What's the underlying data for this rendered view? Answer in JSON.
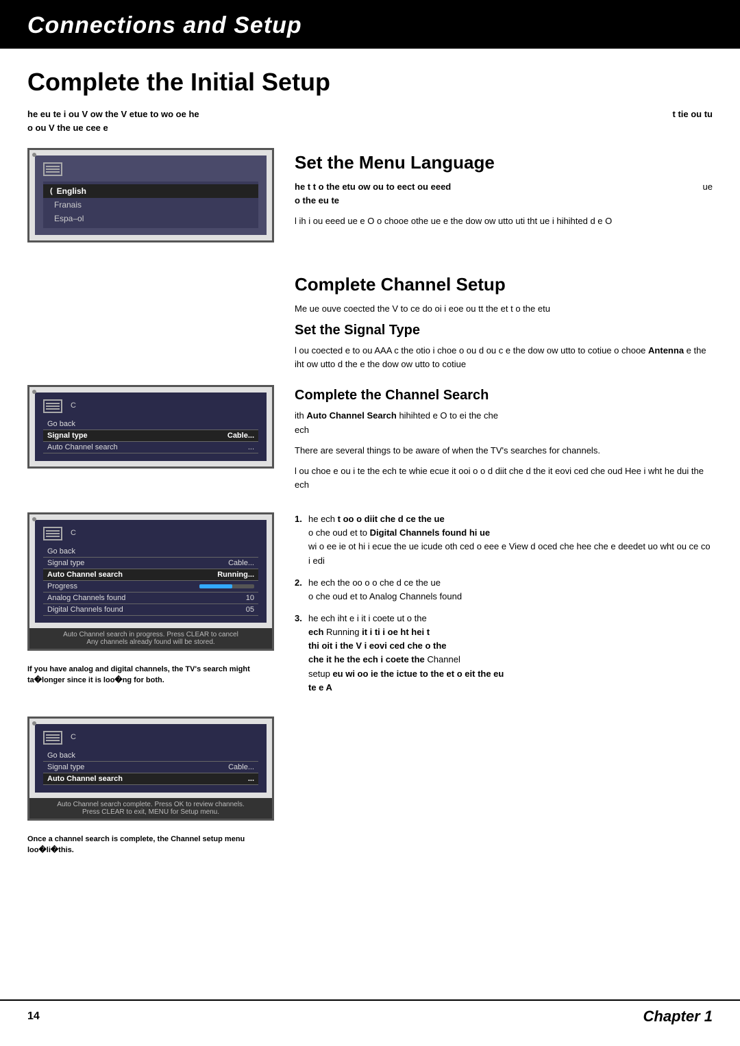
{
  "header": {
    "title": "Connections and Setup"
  },
  "page": {
    "title": "Complete the Initial Setup",
    "intro_line1": "he eu te i ou V ow the V etue to wo oe he",
    "intro_line1_right": "t tie ou tu",
    "intro_line2": "o ou V the ue cee e"
  },
  "menu_language_section": {
    "heading": "Set the Menu Language",
    "body1_bold": "he  t t o the etu ow ou to eect ou eeed",
    "body1_right": "ue",
    "body1_line2": "o the eu te",
    "body2": "l ih i ou eeed ue e O o chooe othe ue e the dow ow utto uti tht ue i hihihted d e O"
  },
  "tv_screen_language": {
    "corner": "●",
    "icon_label": "",
    "menu_items": [
      {
        "label": "English",
        "selected": true,
        "check": "("
      },
      {
        "label": "Franais",
        "selected": false,
        "check": ""
      },
      {
        "label": "Espa–ol",
        "selected": false,
        "check": ""
      }
    ]
  },
  "channel_setup_section": {
    "heading": "Complete Channel Setup",
    "body1": "Me ue ouve coected the V to ce do  oi i eoe ou tt the et t o the etu"
  },
  "signal_type_section": {
    "sub_heading": "Set the Signal Type",
    "body1": "l ou coected e to ou AAA c the otio i choe o ou d ou c e the dow ow utto to cotiue o chooe",
    "body1_antenna": "Antenna",
    "body1_cont": "e the iht ow utto d the e the dow ow utto to cotiue"
  },
  "tv_screen_signal": {
    "c_label": "C",
    "rows": [
      {
        "label": "Go back",
        "value": "",
        "highlighted": false
      },
      {
        "label": "Signal type",
        "value": "Cable...",
        "highlighted": true
      },
      {
        "label": "Auto Channel search",
        "value": "...",
        "highlighted": false
      }
    ]
  },
  "channel_search_section": {
    "sub_heading": "Complete the Channel Search",
    "body_prefix": "ith",
    "body_bold": "Auto Channel Search",
    "body_mid": "hihihted e O to ei the che",
    "body_end": "ech",
    "note": "There are several things to be aware of when the TV's searches for channels.",
    "body2": "l ou choe e  ou i te the ech te  whie ecue it ooi o o d diit che d the it eovi ced che oud Hee i wht he dui the ech"
  },
  "tv_screen_running": {
    "c_label": "C",
    "rows": [
      {
        "label": "Go back",
        "value": "",
        "highlighted": false
      },
      {
        "label": "Signal type",
        "value": "Cable...",
        "highlighted": false
      },
      {
        "label": "Auto Channel search",
        "value": "Running...",
        "highlighted": true
      },
      {
        "label": "Progress",
        "value": "bar",
        "highlighted": false
      },
      {
        "label": "Analog Channels found",
        "value": "10",
        "highlighted": false
      },
      {
        "label": "Digital Channels found",
        "value": "05",
        "highlighted": false
      }
    ],
    "note": "Auto Channel search in progress. Press CLEAR to cancel",
    "note2": "Any channels already found will be stored."
  },
  "tv_screen_running_caption": "If you have analog and digital channels, the TV's search might ta�longer since it is loo�ng for both.",
  "numbered_items": [
    {
      "num": "1.",
      "text_before": "he ech",
      "text_bold1": "t oo o diit che d ce the ue",
      "text_after1": "o che oud et to",
      "text_bold2": "Digital Channels found",
      "text_after2": "hi ue wi o ee ie  ot hi i ecue the ue icude oth ced o eee  e View d oced che hee che e deedet uo wht ou ce co i edi"
    },
    {
      "num": "2.",
      "text_before": "he ech the oo o o che d ce the ue",
      "text_after1": "o che oud et to",
      "text_bold2": "Analog Channels found"
    },
    {
      "num": "3.",
      "text_before": "he ech iht e  i it i coete ut  o the",
      "text_bold1": "ech",
      "text_mid": "Running",
      "text_bold2": "it i ti i oe ht hei t thi oit i the V i eovi ced che o the che it he the ech i",
      "text_bold3": "coete the",
      "text_right": "Channel",
      "text_last": "setup eu wi oo ie the ictue to the et o eit the eu te e A"
    }
  ],
  "tv_screen_complete": {
    "c_label": "C",
    "rows": [
      {
        "label": "Go back",
        "value": "",
        "highlighted": false
      },
      {
        "label": "Signal type",
        "value": "Cable...",
        "highlighted": false
      },
      {
        "label": "Auto Channel search",
        "value": "...",
        "highlighted": true
      }
    ],
    "note": "Auto Channel search complete. Press OK to review channels.",
    "note2": "Press CLEAR to exit, MENU for Setup menu."
  },
  "tv_screen_complete_caption": "Once a channel search is complete, the Channel setup menu loo�li�this.",
  "footer": {
    "page_num": "14",
    "chapter": "Chapter 1"
  }
}
